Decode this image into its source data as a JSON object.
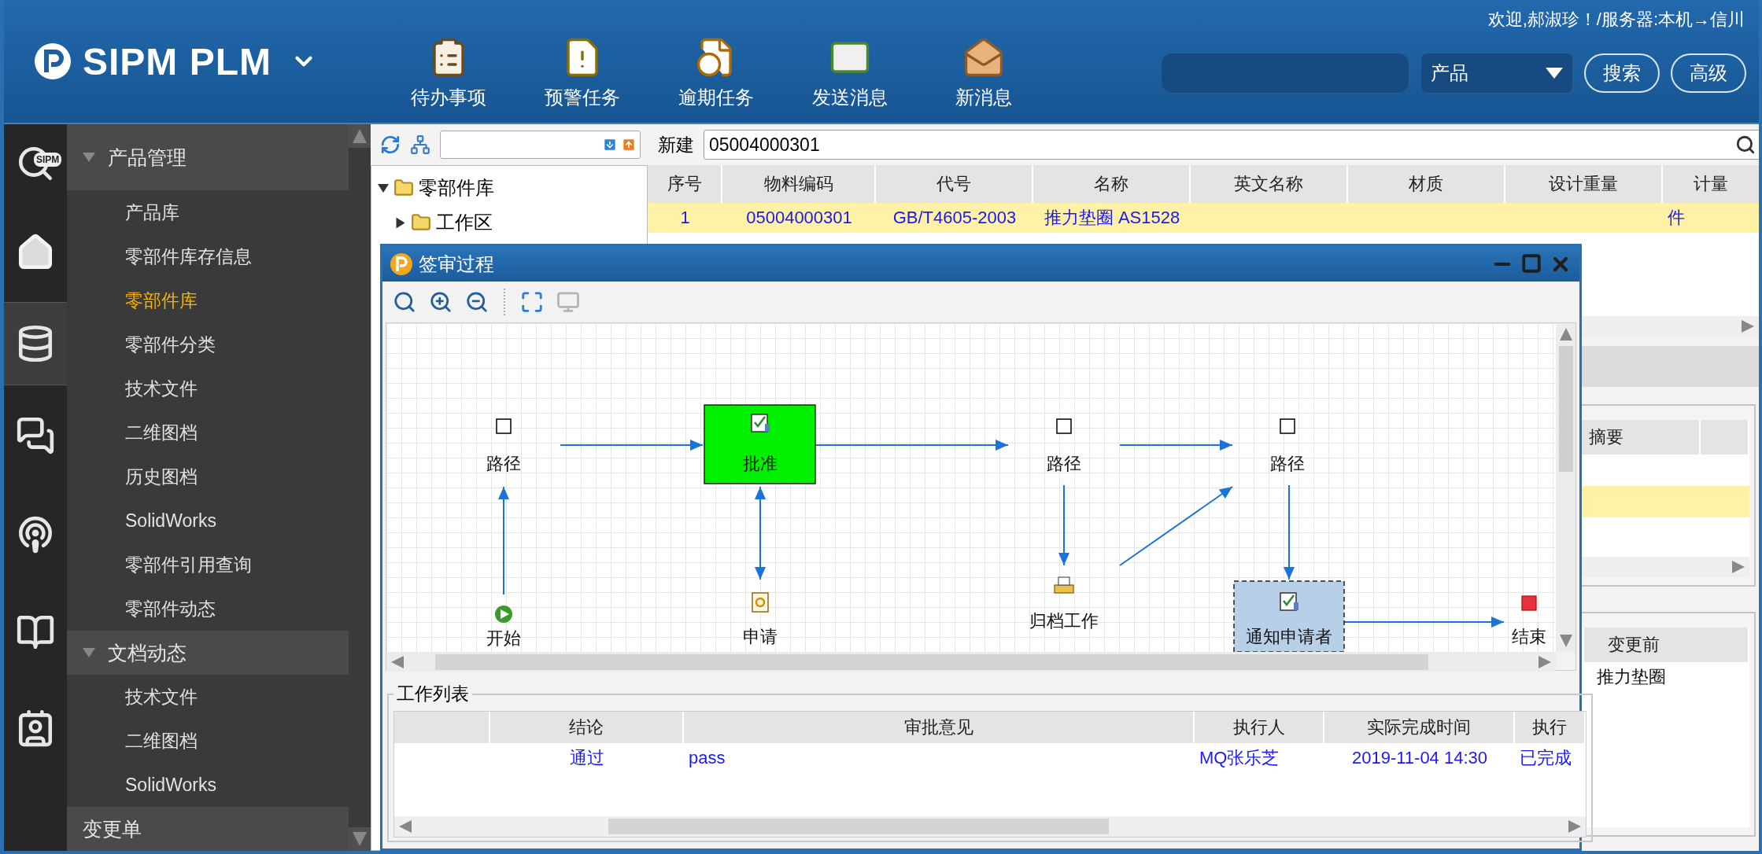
{
  "header": {
    "logo": "SIPM PLM",
    "greeting": "欢迎,郝淑珍！/服务器:本机→信川",
    "tools": [
      {
        "kind": "todo",
        "label": "待办事项"
      },
      {
        "kind": "warning",
        "label": "预警任务"
      },
      {
        "kind": "overdue",
        "label": "逾期任务"
      },
      {
        "kind": "send",
        "label": "发送消息"
      },
      {
        "kind": "inbox",
        "label": "新消息"
      }
    ],
    "category": "产品",
    "buttons": [
      "搜索",
      "高级"
    ]
  },
  "rail": [
    {
      "kind": "search",
      "badge": "SIPM",
      "selected": false
    },
    {
      "kind": "home",
      "selected": false
    },
    {
      "kind": "database",
      "selected": true
    },
    {
      "kind": "chat",
      "selected": false
    },
    {
      "kind": "broadcast",
      "selected": false
    },
    {
      "kind": "book",
      "selected": false
    },
    {
      "kind": "contact",
      "selected": false
    }
  ],
  "nav": [
    {
      "label": "产品管理",
      "children": [
        {
          "label": "产品库",
          "selected": false
        },
        {
          "label": "零部件库存信息",
          "selected": false
        },
        {
          "label": "零部件库",
          "selected": true
        },
        {
          "label": "零部件分类",
          "selected": false
        },
        {
          "label": "技术文件",
          "selected": false
        },
        {
          "label": "二维图档",
          "selected": false
        },
        {
          "label": "历史图档",
          "selected": false
        },
        {
          "label": "SolidWorks",
          "selected": false
        },
        {
          "label": "零部件引用查询",
          "selected": false
        },
        {
          "label": "零部件动态",
          "selected": false
        }
      ]
    },
    {
      "label": "文档动态",
      "children": [
        {
          "label": "技术文件",
          "selected": false
        },
        {
          "label": "二维图档",
          "selected": false
        },
        {
          "label": "SolidWorks",
          "selected": false
        }
      ]
    },
    {
      "label": "变更单"
    }
  ],
  "search_bar": {
    "label": "新建",
    "value": "05004000301"
  },
  "tree": [
    {
      "label": "零部件库",
      "expanded": true,
      "children": [
        {
          "label": "工作区",
          "expanded": false
        }
      ]
    }
  ],
  "parts_table": {
    "columns": [
      "序号",
      "物料编码",
      "代号",
      "名称",
      "英文名称",
      "材质",
      "设计重量",
      "计量"
    ],
    "rows": [
      {
        "selected": true,
        "cells": [
          "1",
          "05004000301",
          "GB/T4605-2003",
          "推力垫圈 AS1528",
          null,
          null,
          null,
          "件"
        ]
      }
    ]
  },
  "summary_table": {
    "columns": [
      "摘要"
    ],
    "rows": [
      {
        "selected": true
      }
    ]
  },
  "change_table": {
    "columns": [
      "变更前"
    ],
    "rows": [
      [
        "推力垫圈"
      ]
    ]
  },
  "dialog": {
    "title": "签审过程",
    "tools": [
      {
        "kind": "zoom",
        "disabled": false
      },
      {
        "kind": "zoom-in",
        "disabled": false
      },
      {
        "kind": "zoom-out",
        "disabled": false
      },
      {
        "kind": "fit",
        "disabled": false
      },
      {
        "kind": "overview",
        "disabled": true
      }
    ],
    "nodes": [
      {
        "kind": "route",
        "label": "路径",
        "selected": false,
        "highlight": false
      },
      {
        "kind": "task",
        "label": "批准",
        "selected": false,
        "highlight": true
      },
      {
        "kind": "route",
        "label": "路径",
        "selected": false,
        "highlight": false
      },
      {
        "kind": "route",
        "label": "路径",
        "selected": false,
        "highlight": false
      },
      {
        "kind": "start",
        "label": "开始",
        "selected": false,
        "highlight": false
      },
      {
        "kind": "apply",
        "label": "申请",
        "selected": false,
        "highlight": false
      },
      {
        "kind": "archive",
        "label": "归档工作",
        "selected": false,
        "highlight": false
      },
      {
        "kind": "task",
        "label": "通知申请者",
        "selected": true,
        "highlight": false
      },
      {
        "kind": "end",
        "label": "结束",
        "selected": false,
        "highlight": false
      }
    ],
    "edges": [
      {
        "bidirectional": false
      },
      {
        "bidirectional": false
      },
      {
        "bidirectional": false
      },
      {
        "bidirectional": false
      },
      {
        "bidirectional": true
      },
      {
        "bidirectional": false
      },
      {
        "bidirectional": false
      },
      {
        "bidirectional": false
      },
      {
        "bidirectional": false
      }
    ],
    "worklist": {
      "title": "工作列表",
      "columns": [
        null,
        "结论",
        "审批意见",
        "执行人",
        "实际完成时间",
        "执行"
      ],
      "rows": [
        [
          null,
          "通过",
          "pass",
          "MQ张乐芝",
          "2019-11-04 14:30",
          "已完成"
        ]
      ]
    }
  }
}
